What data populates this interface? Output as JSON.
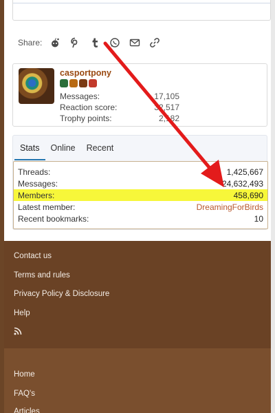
{
  "share": {
    "label": "Share:",
    "icons": [
      "reddit-icon",
      "pinterest-icon",
      "tumblr-icon",
      "whatsapp-icon",
      "email-icon",
      "link-icon"
    ]
  },
  "member": {
    "username": "casportpony",
    "stats": [
      {
        "label": "Messages:",
        "value": "17,105"
      },
      {
        "label": "Reaction score:",
        "value": "32,517"
      },
      {
        "label": "Trophy points:",
        "value": "2,182"
      }
    ],
    "badges": [
      "#2b6e3a",
      "#b86a14",
      "#7b3b14",
      "#c23a2b"
    ]
  },
  "stats_tabs": [
    "Stats",
    "Online",
    "Recent"
  ],
  "forum_stats": [
    {
      "label": "Threads:",
      "value": "1,425,667"
    },
    {
      "label": "Messages:",
      "value": "24,632,493"
    },
    {
      "label": "Members:",
      "value": "458,690"
    },
    {
      "label": "Latest member:",
      "value": "DreamingForBirds"
    },
    {
      "label": "Recent bookmarks:",
      "value": "10"
    }
  ],
  "footer": {
    "links": [
      "Contact us",
      "Terms and rules",
      "Privacy Policy & Disclosure",
      "Help",
      "rss-icon"
    ],
    "links2": [
      "Home",
      "FAQ's",
      "Articles"
    ]
  },
  "colors": {
    "footer_dark": "#6a4225",
    "footer_light": "#7a4f2e",
    "highlight": "#f7f73a",
    "arrow": "#e31b1b",
    "username": "#9a4a12"
  }
}
